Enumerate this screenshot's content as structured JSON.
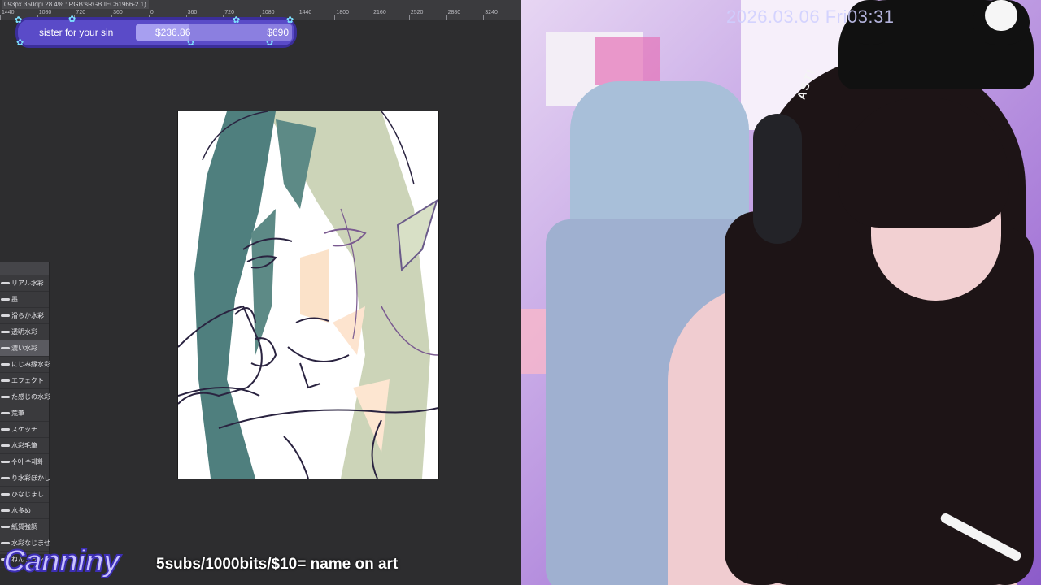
{
  "app": {
    "ruler_info": "093px 350dpi 28.4% : RGB:sRGB IEC61966-2.1)",
    "ruler_ticks": [
      "1440",
      "1080",
      "720",
      "360",
      "0",
      "360",
      "720",
      "1080",
      "1440",
      "1800",
      "2160",
      "2520",
      "2880",
      "3240"
    ]
  },
  "goal": {
    "label": "sister for your sin",
    "current": "$236.86",
    "target": "$690",
    "progress_fraction": 0.343
  },
  "brushes": [
    {
      "label": "リアル水彩",
      "selected": false
    },
    {
      "label": "墨",
      "selected": false
    },
    {
      "label": "滑らか水彩",
      "selected": false
    },
    {
      "label": "透明水彩",
      "selected": false
    },
    {
      "label": "濃い水彩",
      "selected": true
    },
    {
      "label": "にじみ縁水彩",
      "selected": false
    },
    {
      "label": "エフェクト",
      "selected": false
    },
    {
      "label": "た感じの水彩",
      "selected": false
    },
    {
      "label": "荒筆",
      "selected": false
    },
    {
      "label": "スケッチ",
      "selected": false
    },
    {
      "label": "水彩毛筆",
      "selected": false
    },
    {
      "label": "수이 수채화",
      "selected": false
    },
    {
      "label": "り水彩ぼかし",
      "selected": false
    },
    {
      "label": "ひなじまし",
      "selected": false
    },
    {
      "label": "水多め",
      "selected": false
    },
    {
      "label": "紙質強調",
      "selected": false
    },
    {
      "label": "水彩なじませ",
      "selected": false
    },
    {
      "label": "ねんブラシ",
      "selected": false
    }
  ],
  "stream": {
    "logo_text": "Canniny",
    "tagline": "5subs/1000bits/$10= name on art",
    "timestamp": "2026.03.06 Fri03:31",
    "headset_text": "ASTI"
  },
  "colors": {
    "goal_bg": "#5a4bc8",
    "goal_bar": "#8b7fe0",
    "logo": "#c9c2ff",
    "drawing_teal": "#4d7b7a",
    "drawing_sage": "#bcc6a6",
    "drawing_outline": "#2a2340"
  }
}
